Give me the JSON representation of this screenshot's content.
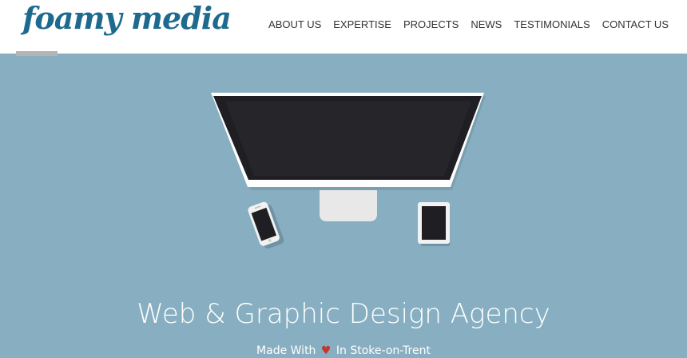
{
  "brand": {
    "logo_text": "foamy media",
    "logo_color": "#1d6a8e"
  },
  "nav": {
    "items": [
      {
        "label": "ABOUT US"
      },
      {
        "label": "EXPERTISE"
      },
      {
        "label": "PROJECTS"
      },
      {
        "label": "NEWS"
      },
      {
        "label": "TESTIMONIALS"
      },
      {
        "label": "CONTACT US"
      }
    ]
  },
  "hero": {
    "background_color": "#87afc1",
    "illustration": [
      "monitor-icon",
      "smartphone-icon",
      "tablet-icon"
    ],
    "headline": "Web & Graphic Design Agency",
    "tagline_before": "Made With",
    "tagline_icon": "heart-icon",
    "tagline_after": "In Stoke-on-Trent"
  }
}
